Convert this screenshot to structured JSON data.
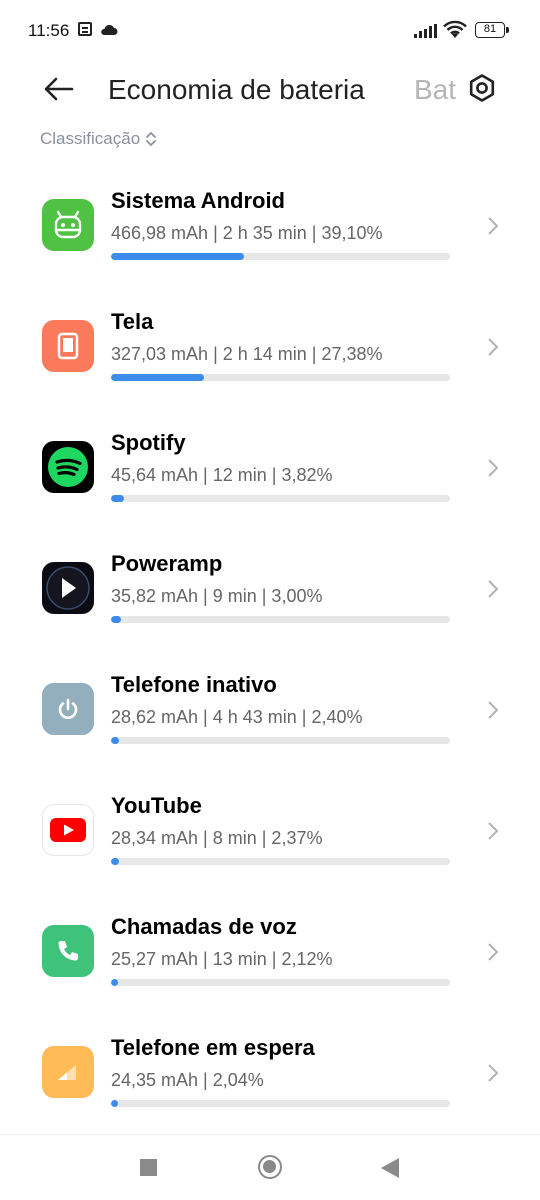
{
  "status_bar": {
    "time": "11:56",
    "battery": "81"
  },
  "header": {
    "title": "Economia de bateria",
    "next_tab": "Bat"
  },
  "sort": {
    "label": "Classificação"
  },
  "colors": {
    "accent": "#3d8bea",
    "track": "#e7e7e7"
  },
  "apps": [
    {
      "name": "Sistema Android",
      "stats": "466,98 mAh | 2 h 35 min  | 39,10%",
      "percent": 39.1,
      "icon": "android-icon",
      "icon_color": "#4fc244"
    },
    {
      "name": "Tela",
      "stats": "327,03 mAh | 2 h 14 min  | 27,38%",
      "percent": 27.38,
      "icon": "screen-icon",
      "icon_color": "#fb7a5c"
    },
    {
      "name": "Spotify",
      "stats": "45,64 mAh | 12 min  | 3,82%",
      "percent": 3.82,
      "icon": "spotify-icon",
      "icon_color": "#000000"
    },
    {
      "name": "Poweramp",
      "stats": "35,82 mAh | 9 min  | 3,00%",
      "percent": 3.0,
      "icon": "poweramp-icon",
      "icon_color": "#0b0b14"
    },
    {
      "name": "Telefone inativo",
      "stats": "28,62 mAh | 4 h 43 min  | 2,40%",
      "percent": 2.4,
      "icon": "power-icon",
      "icon_color": "#93aebc"
    },
    {
      "name": "YouTube",
      "stats": "28,34 mAh | 8 min  | 2,37%",
      "percent": 2.37,
      "icon": "youtube-icon",
      "icon_color": "#ffffff"
    },
    {
      "name": "Chamadas de voz",
      "stats": "25,27 mAh | 13 min  | 2,12%",
      "percent": 2.12,
      "icon": "phone-icon",
      "icon_color": "#3fc27a"
    },
    {
      "name": "Telefone em espera",
      "stats": "24,35 mAh | 2,04%",
      "percent": 2.04,
      "icon": "signal-icon",
      "icon_color": "#ffbb55"
    }
  ]
}
